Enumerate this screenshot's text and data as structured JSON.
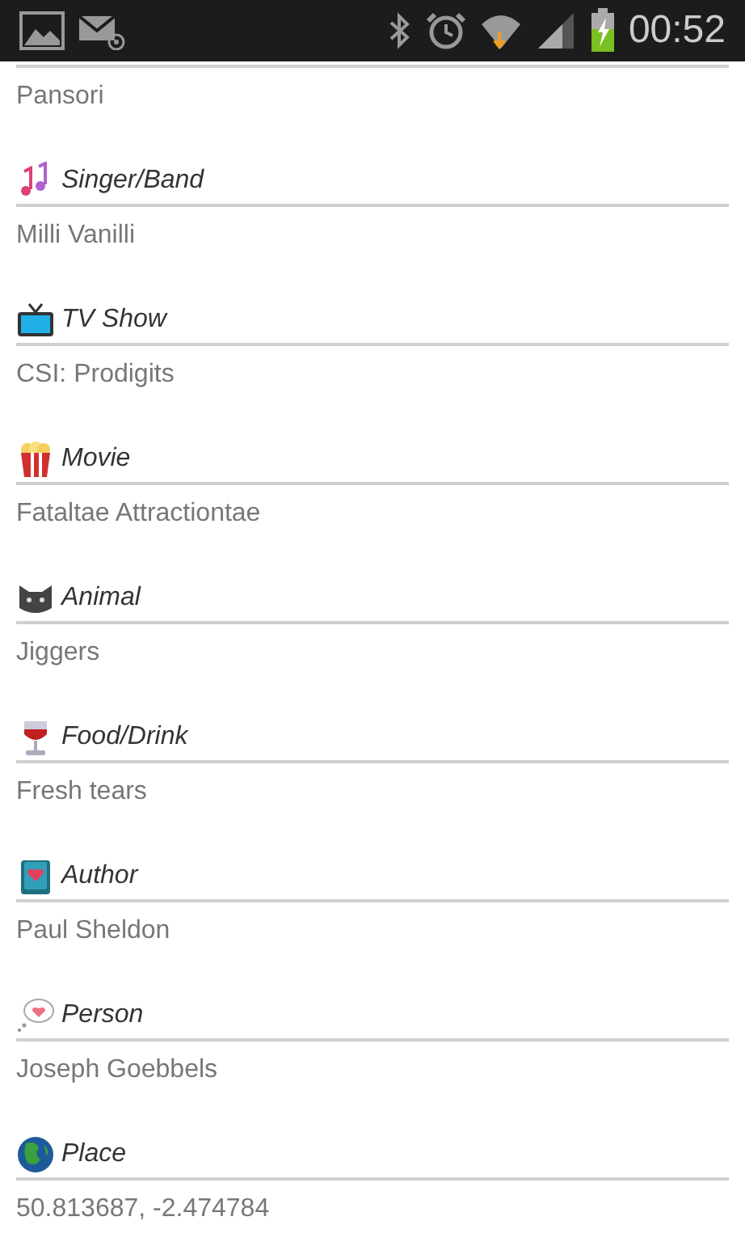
{
  "status_bar": {
    "time": "00:52"
  },
  "first_value": "Pansori",
  "fields": [
    {
      "kind": "music",
      "label": "Singer/Band",
      "value": "Milli Vanilli"
    },
    {
      "kind": "tv",
      "label": "TV Show",
      "value": "CSI: Prodigits"
    },
    {
      "kind": "popcorn",
      "label": "Movie",
      "value": "Fataltae Attractiontae"
    },
    {
      "kind": "cat",
      "label": "Animal",
      "value": "Jiggers"
    },
    {
      "kind": "wine",
      "label": "Food/Drink",
      "value": "Fresh tears"
    },
    {
      "kind": "book",
      "label": "Author",
      "value": "Paul Sheldon"
    },
    {
      "kind": "speech",
      "label": "Person",
      "value": "Joseph Goebbels"
    },
    {
      "kind": "globe",
      "label": "Place",
      "value": "50.813687, -2.474784"
    }
  ]
}
